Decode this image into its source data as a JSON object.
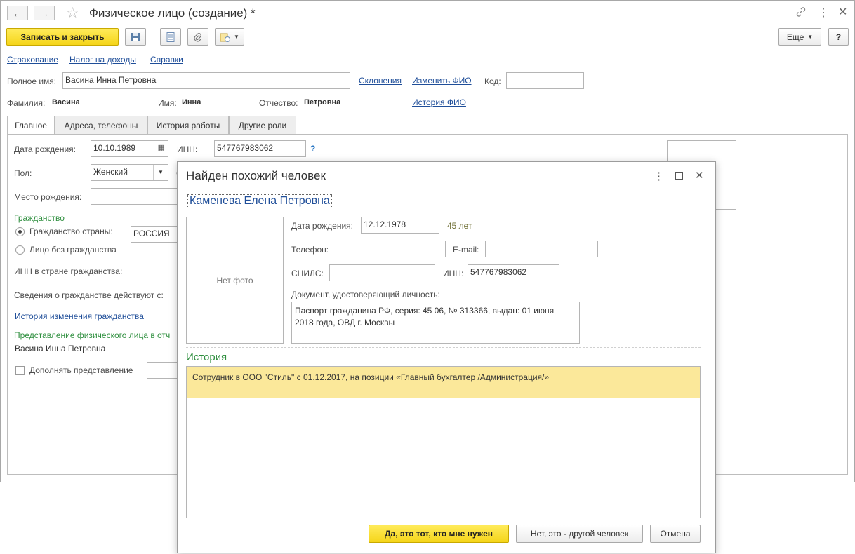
{
  "window": {
    "title": "Физическое лицо (создание) *",
    "save_close": "Записать и закрыть",
    "more": "Еще",
    "help": "?"
  },
  "links": {
    "insurance": "Страхование",
    "income_tax": "Налог на доходы",
    "certificates": "Справки",
    "declensions": "Склонения",
    "change_fio": "Изменить ФИО",
    "history_fio": "История ФИО"
  },
  "fullname": {
    "label": "Полное имя:",
    "value": "Васина Инна Петровна",
    "code_label": "Код:",
    "code_value": ""
  },
  "name_parts": {
    "surname_label": "Фамилия:",
    "surname": "Васина",
    "name_label": "Имя:",
    "name": "Инна",
    "patronymic_label": "Отчество:",
    "patronymic": "Петровна"
  },
  "tabs": [
    "Главное",
    "Адреса, телефоны",
    "История работы",
    "Другие роли"
  ],
  "main_tab": {
    "birth_label": "Дата рождения:",
    "birth_value": "10.10.1989",
    "inn_label": "ИНН:",
    "inn_value": "547767983062",
    "inn_help": "?",
    "gender_label": "Пол:",
    "gender_value": "Женский",
    "birthplace_label": "Место рождения:",
    "citizenship_header": "Гражданство",
    "citizenship_country": "Гражданство страны:",
    "country_value": "РОССИЯ",
    "no_citizenship": "Лицо без гражданства",
    "inn_country": "ИНН в стране гражданства:",
    "citizenship_since": "Сведения о гражданстве действуют с:",
    "citizenship_history": "История изменения гражданства",
    "representation_header": "Представление физического лица в отч",
    "representation_value": "Васина Инна Петровна",
    "supplement": "Дополнять представление"
  },
  "dialog": {
    "title": "Найден похожий человек",
    "person": "Каменева Елена Петровна",
    "no_photo": "Нет фото",
    "birth_label": "Дата рождения:",
    "birth_value": "12.12.1978",
    "age": "45 лет",
    "phone_label": "Телефон:",
    "email_label": "E-mail:",
    "snils_label": "СНИЛС:",
    "inn_label": "ИНН:",
    "inn_value": "547767983062",
    "document_label": "Документ, удостоверяющий личность:",
    "document_line1": "Паспорт гражданина РФ, серия: 45 06, № 313366, выдан: 01 июня",
    "document_line2": "2018 года, ОВД г. Москвы",
    "history_header": "История",
    "history_items": [
      "Сотрудник в ООО \"Стиль\" с 01.12.2017, на позиции «Главный бухгалтер /Администрация/»"
    ],
    "btn_yes": "Да, это тот, кто мне нужен",
    "btn_no": "Нет, это - другой человек",
    "btn_cancel": "Отмена"
  },
  "colors": {
    "accent_yellow": "#f5d51a",
    "link_blue": "#1f4e99",
    "group_green": "#2f8f3f",
    "history_highlight": "#fbe89a"
  }
}
